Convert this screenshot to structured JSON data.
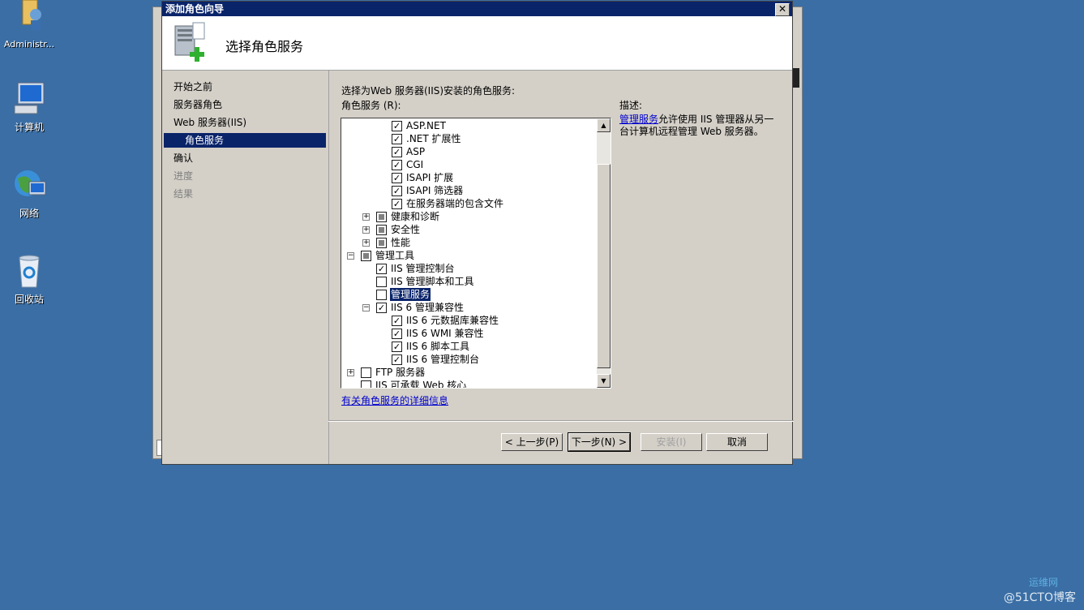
{
  "desktop": {
    "icons": [
      {
        "label": "Administr..."
      },
      {
        "label": "计算机"
      },
      {
        "label": "网络"
      },
      {
        "label": "回收站"
      }
    ]
  },
  "dialog": {
    "title": "添加角色向导",
    "header_title": "选择角色服务",
    "nav": [
      {
        "label": "开始之前",
        "state": "normal"
      },
      {
        "label": "服务器角色",
        "state": "normal"
      },
      {
        "label": "Web 服务器(IIS)",
        "state": "normal"
      },
      {
        "label": "角色服务",
        "state": "selected"
      },
      {
        "label": "确认",
        "state": "normal"
      },
      {
        "label": "进度",
        "state": "disabled"
      },
      {
        "label": "结果",
        "state": "disabled"
      }
    ],
    "prompt": "选择为Web 服务器(IIS)安装的角色服务:",
    "list_label": "角色服务 (R):",
    "services": [
      {
        "label": "ASP.NET",
        "checked": true
      },
      {
        "label": ".NET 扩展性",
        "checked": true
      },
      {
        "label": "ASP",
        "checked": true
      },
      {
        "label": "CGI",
        "checked": true
      },
      {
        "label": "ISAPI 扩展",
        "checked": true
      },
      {
        "label": "ISAPI 筛选器",
        "checked": true
      },
      {
        "label": "在服务器端的包含文件",
        "checked": true
      },
      {
        "label": "健康和诊断",
        "state": "partial",
        "expander": "+"
      },
      {
        "label": "安全性",
        "state": "partial",
        "expander": "+"
      },
      {
        "label": "性能",
        "state": "partial",
        "expander": "+"
      },
      {
        "label": "管理工具",
        "state": "partial",
        "expander": "-"
      },
      {
        "label": "IIS 管理控制台",
        "checked": true
      },
      {
        "label": "IIS 管理脚本和工具",
        "checked": false
      },
      {
        "label": "管理服务",
        "checked": false,
        "highlighted": true
      },
      {
        "label": "IIS 6 管理兼容性",
        "checked": true,
        "expander": "-"
      },
      {
        "label": "IIS 6 元数据库兼容性",
        "checked": true
      },
      {
        "label": "IIS 6 WMI 兼容性",
        "checked": true
      },
      {
        "label": "IIS 6 脚本工具",
        "checked": true
      },
      {
        "label": "IIS 6 管理控制台",
        "checked": true
      },
      {
        "label": "FTP 服务器",
        "checked": false,
        "expander": "+"
      },
      {
        "label": "IIS 可承载 Web 核心",
        "checked": false
      }
    ],
    "more_info_link": "有关角色服务的详细信息",
    "description": {
      "heading": "描述:",
      "link": "管理服务",
      "text": "允许使用 IIS 管理器从另一台计算机远程管理 Web 服务器。"
    },
    "buttons": {
      "back": "< 上一步(P)",
      "next": "下一步(N) >",
      "install": "安装(I)",
      "cancel": "取消"
    }
  },
  "watermark": {
    "line1": "运维网",
    "line2": "@51CTO博客"
  }
}
